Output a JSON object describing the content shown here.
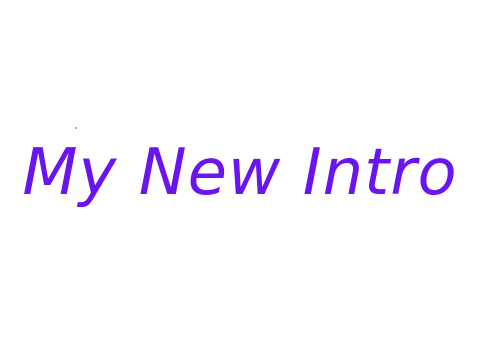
{
  "title": {
    "text": "My New Intro",
    "color": "#6a14f0"
  },
  "background": "#ffffff"
}
